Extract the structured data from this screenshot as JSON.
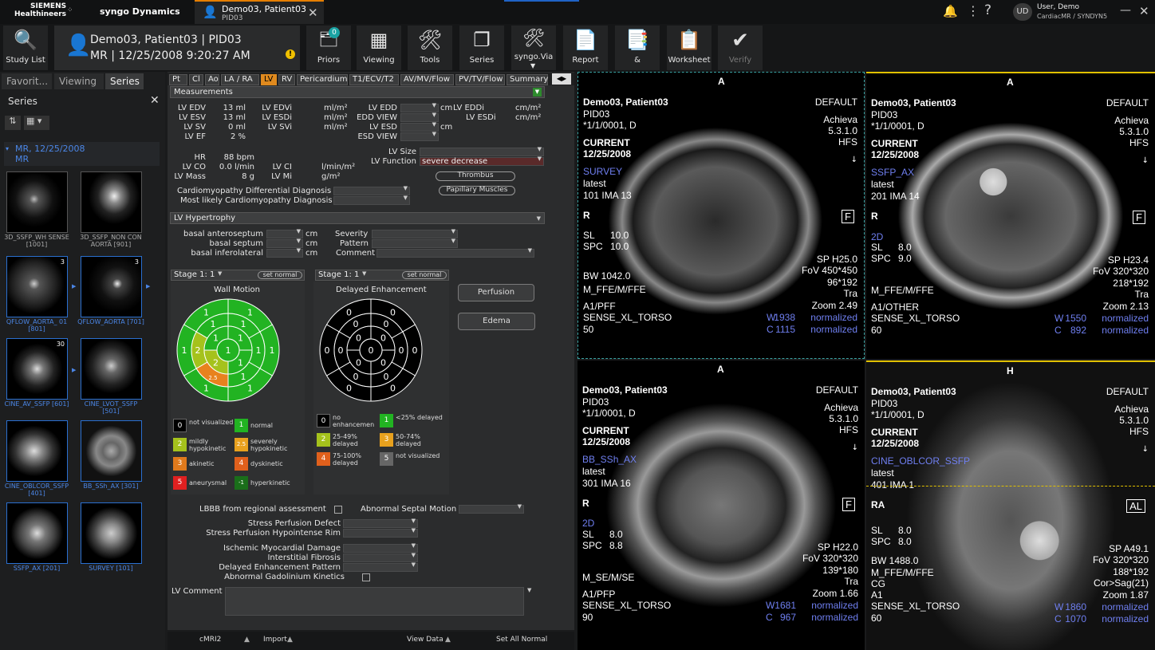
{
  "topbar": {
    "brand_line1": "SIEMENS",
    "brand_line2": "Healthineers",
    "app_name": "syngo Dynamics",
    "tab_title": "Demo03, Patient03",
    "tab_sub": "PID03",
    "user_initials": "UD",
    "user_name": "User, Demo",
    "user_detail": "CardiacMR / SYNDYN5"
  },
  "toolbar": {
    "study_list": "Study List",
    "patient_line1": "Demo03, Patient03 | PID03",
    "patient_line2": "MR | 12/25/2008 9:20:27 AM",
    "priors": "Priors",
    "priors_badge": "0",
    "viewing": "Viewing",
    "tools": "Tools",
    "series": "Series",
    "syngovia": "syngo.Via",
    "report": "Report",
    "amp": "&",
    "worksheet": "Worksheet",
    "verify": "Verify"
  },
  "left": {
    "tabs": [
      "Favorit...",
      "Viewing",
      "Series"
    ],
    "header": "Series",
    "group": "MR, 12/25/2008",
    "group2": "MR",
    "thumbs": [
      {
        "label": "3D_SSFP_WH SENSE [1001]",
        "count": ""
      },
      {
        "label": "3D_SSFP_NON CON AORTA [901]",
        "count": ""
      },
      {
        "label": "QFLOW_AORTA_ 01 [801]",
        "count": "3"
      },
      {
        "label": "QFLOW_AORTA [701]",
        "count": "3"
      },
      {
        "label": "CINE_AV_SSFP [601]",
        "count": "30"
      },
      {
        "label": "CINE_LVOT_SSFP [501]",
        "count": ""
      },
      {
        "label": "CINE_OBLCOR_SSFP [401]",
        "count": ""
      },
      {
        "label": "BB_SSh_AX [301]",
        "count": ""
      },
      {
        "label": "SSFP_AX [201]",
        "count": ""
      },
      {
        "label": "SURVEY [101]",
        "count": ""
      }
    ]
  },
  "center": {
    "tabs": [
      "Pt",
      "Cl",
      "Ao",
      "LA / RA",
      "LV",
      "RV",
      "Pericardium",
      "T1/ECV/T2",
      "AV/MV/Flow",
      "PV/TV/Flow",
      "Summary"
    ],
    "measurements_header": "Measurements",
    "lv_edv": "LV EDV",
    "lv_edv_val": "13 ml",
    "lv_esv": "LV ESV",
    "lv_esv_val": "13 ml",
    "lv_sv": "LV SV",
    "lv_sv_val": "0 ml",
    "lv_ef": "LV EF",
    "lv_ef_val": "2 %",
    "lv_edvi": "LV EDVi",
    "lv_esdi": "LV ESDi",
    "lv_svi": "LV SVi",
    "ml_m2": "ml/m²",
    "lv_edd": "LV EDD",
    "edd_view": "EDD VIEW",
    "lv_esd": "LV ESD",
    "esd_view": "ESD VIEW",
    "cm": "cm",
    "lv_eddi": "LV EDDi",
    "lv_esdi2": "LV ESDi",
    "cm_m2": "cm/m²",
    "hr": "HR",
    "hr_val": "88 bpm",
    "lv_co": "LV CO",
    "lv_co_val": "0.0 l/min",
    "lv_mass": "LV Mass",
    "lv_mass_val": "8 g",
    "lv_ci": "LV CI",
    "l_min_m2": "l/min/m²",
    "lv_mi": "LV Mi",
    "g_m2": "g/m²",
    "lv_size": "LV Size",
    "lv_function": "LV Function",
    "lv_function_val": "severe decrease",
    "thrombus": "Thrombus",
    "papillary": "Papillary Muscles",
    "cardio_dd": "Cardiomyopathy Differential Diagnosis",
    "cardio_likely": "Most likely Cardiomyopathy Diagnosis",
    "hypertrophy_header": "LV Hypertrophy",
    "basal_antero": "basal anteroseptum",
    "basal_septum": "basal septum",
    "basal_infero": "basal inferolateral",
    "severity": "Severity",
    "pattern": "Pattern",
    "comment": "Comment",
    "stage_left": "Stage 1: 1",
    "stage_right": "Stage 1: 1",
    "set_normal": "set normal",
    "wall_motion": "Wall Motion",
    "delayed_enh": "Delayed Enhancement",
    "perfusion": "Perfusion",
    "edema": "Edema",
    "wm_legend": [
      {
        "code": "0",
        "text": "not visualized"
      },
      {
        "code": "1",
        "text": "normal"
      },
      {
        "code": "2",
        "text": "mildly hypokinetic"
      },
      {
        "code": "2.5",
        "text": "severely hypokinetic"
      },
      {
        "code": "3",
        "text": "akinetic"
      },
      {
        "code": "4",
        "text": "dyskinetic"
      },
      {
        "code": "5",
        "text": "aneurysmal"
      },
      {
        "code": "-1",
        "text": "hyperkinetic"
      }
    ],
    "de_legend": [
      {
        "code": "0",
        "text": "no enhancemen"
      },
      {
        "code": "1",
        "text": "<25% delayed"
      },
      {
        "code": "2",
        "text": "25-49% delayed"
      },
      {
        "code": "3",
        "text": "50-74% delayed"
      },
      {
        "code": "4",
        "text": "75-100% delayed"
      },
      {
        "code": "5",
        "text": "not visualized"
      }
    ],
    "lbbb": "LBBB from regional assessment",
    "abn_septal": "Abnormal Septal Motion",
    "stress_def": "Stress Perfusion Defect",
    "stress_rim": "Stress Perfusion Hypointense Rim",
    "ischemic": "Ischemic Myocardial Damage",
    "interstitial": "Interstitial Fibrosis",
    "delayed_pattern": "Delayed Enhancement Pattern",
    "abn_gado": "Abnormal Gadolinium Kinetics",
    "lv_comment": "LV Comment"
  },
  "bottom": {
    "cmri": "cMRI2",
    "import": "Import",
    "view_data": "View Data",
    "set_all": "Set All Normal"
  },
  "wm_segments": [
    "1",
    "1",
    "1",
    "1",
    "1",
    "1",
    "1",
    "1",
    "1",
    "1",
    "2.5",
    "2",
    "1",
    "1",
    "2",
    "1",
    "1"
  ],
  "viewports": [
    {
      "orient": "A",
      "name": "Demo03, Patient03",
      "pid": "PID03",
      "img": "*1/1/0001, D",
      "cur": "CURRENT",
      "date": "12/25/2008",
      "series": "SURVEY",
      "latest": "latest",
      "ima": "101 IMA 13",
      "lr": "R",
      "f": "F",
      "sl": "SL",
      "slv": "10.0",
      "spc": "SPC",
      "spcv": "10.0",
      "bw": "BW 1042.0",
      "seq": "M_FFE/M/FFE",
      "coil1": "A1/PFF",
      "coil2": "SENSE_XL_TORSO",
      "n": "50",
      "def": "DEFAULT",
      "mfr": "Achieva",
      "ver": "5.3.1.0",
      "pos": "HFS",
      "sp": "SP H25.0",
      "fov": "FoV 450*450",
      "mat": "96*192",
      "plane": "Tra",
      "zoom": "Zoom 2.49",
      "w": "W",
      "wv": "1938",
      "c": "C",
      "cv": "1115",
      "norm": "normalized",
      "d2": ""
    },
    {
      "orient": "A",
      "name": "Demo03, Patient03",
      "pid": "PID03",
      "img": "*1/1/0001, D",
      "cur": "CURRENT",
      "date": "12/25/2008",
      "series": "SSFP_AX",
      "latest": "latest",
      "ima": "201 IMA 14",
      "lr": "R",
      "f": "F",
      "sl": "SL",
      "slv": "8.0",
      "spc": "SPC",
      "spcv": "9.0",
      "bw": "",
      "seq": "M_FFE/M/FFE",
      "coil1": "A1/OTHER",
      "coil2": "SENSE_XL_TORSO",
      "n": "60",
      "def": "DEFAULT",
      "mfr": "Achieva",
      "ver": "5.3.1.0",
      "pos": "HFS",
      "sp": "SP H23.4",
      "fov": "FoV 320*320",
      "mat": "218*192",
      "plane": "Tra",
      "zoom": "Zoom 2.13",
      "w": "W",
      "wv": "1550",
      "c": "C",
      "cv": "892",
      "norm": "normalized",
      "d2": "2D"
    },
    {
      "orient": "A",
      "name": "Demo03, Patient03",
      "pid": "PID03",
      "img": "*1/1/0001, D",
      "cur": "CURRENT",
      "date": "12/25/2008",
      "series": "BB_SSh_AX",
      "latest": "latest",
      "ima": "301 IMA 16",
      "lr": "R",
      "f": "F",
      "sl": "SL",
      "slv": "8.0",
      "spc": "SPC",
      "spcv": "8.8",
      "bw": "",
      "seq": "M_SE/M/SE",
      "coil1": "A1/PFP",
      "coil2": "SENSE_XL_TORSO",
      "n": "90",
      "def": "DEFAULT",
      "mfr": "Achieva",
      "ver": "5.3.1.0",
      "pos": "HFS",
      "sp": "SP H22.0",
      "fov": "FoV 320*320",
      "mat": "139*180",
      "plane": "Tra",
      "zoom": "Zoom 1.66",
      "w": "W",
      "wv": "1681",
      "c": "C",
      "cv": "967",
      "norm": "normalized",
      "d2": "2D"
    },
    {
      "orient": "H",
      "name": "Demo03, Patient03",
      "pid": "PID03",
      "img": "*1/1/0001, D",
      "cur": "CURRENT",
      "date": "12/25/2008",
      "series": "CINE_OBLCOR_SSFP",
      "latest": "latest",
      "ima": "401 IMA 1",
      "lr": "RA",
      "f": "AL",
      "sl": "SL",
      "slv": "8.0",
      "spc": "SPC",
      "spcv": "8.0",
      "bw": "BW 1488.0",
      "seq": "M_FFE/M/FFE",
      "coil1": "CG",
      "coil1b": "A1",
      "coil2": "SENSE_XL_TORSO",
      "n": "60",
      "def": "DEFAULT",
      "mfr": "Achieva",
      "ver": "5.3.1.0",
      "pos": "HFS",
      "sp": "SP A49.1",
      "fov": "FoV 320*320",
      "mat": "188*192",
      "plane": "Cor>Sag(21)",
      "zoom": "Zoom 1.87",
      "w": "W",
      "wv": "1860",
      "c": "C",
      "cv": "1070",
      "norm": "normalized",
      "d2": ""
    }
  ]
}
